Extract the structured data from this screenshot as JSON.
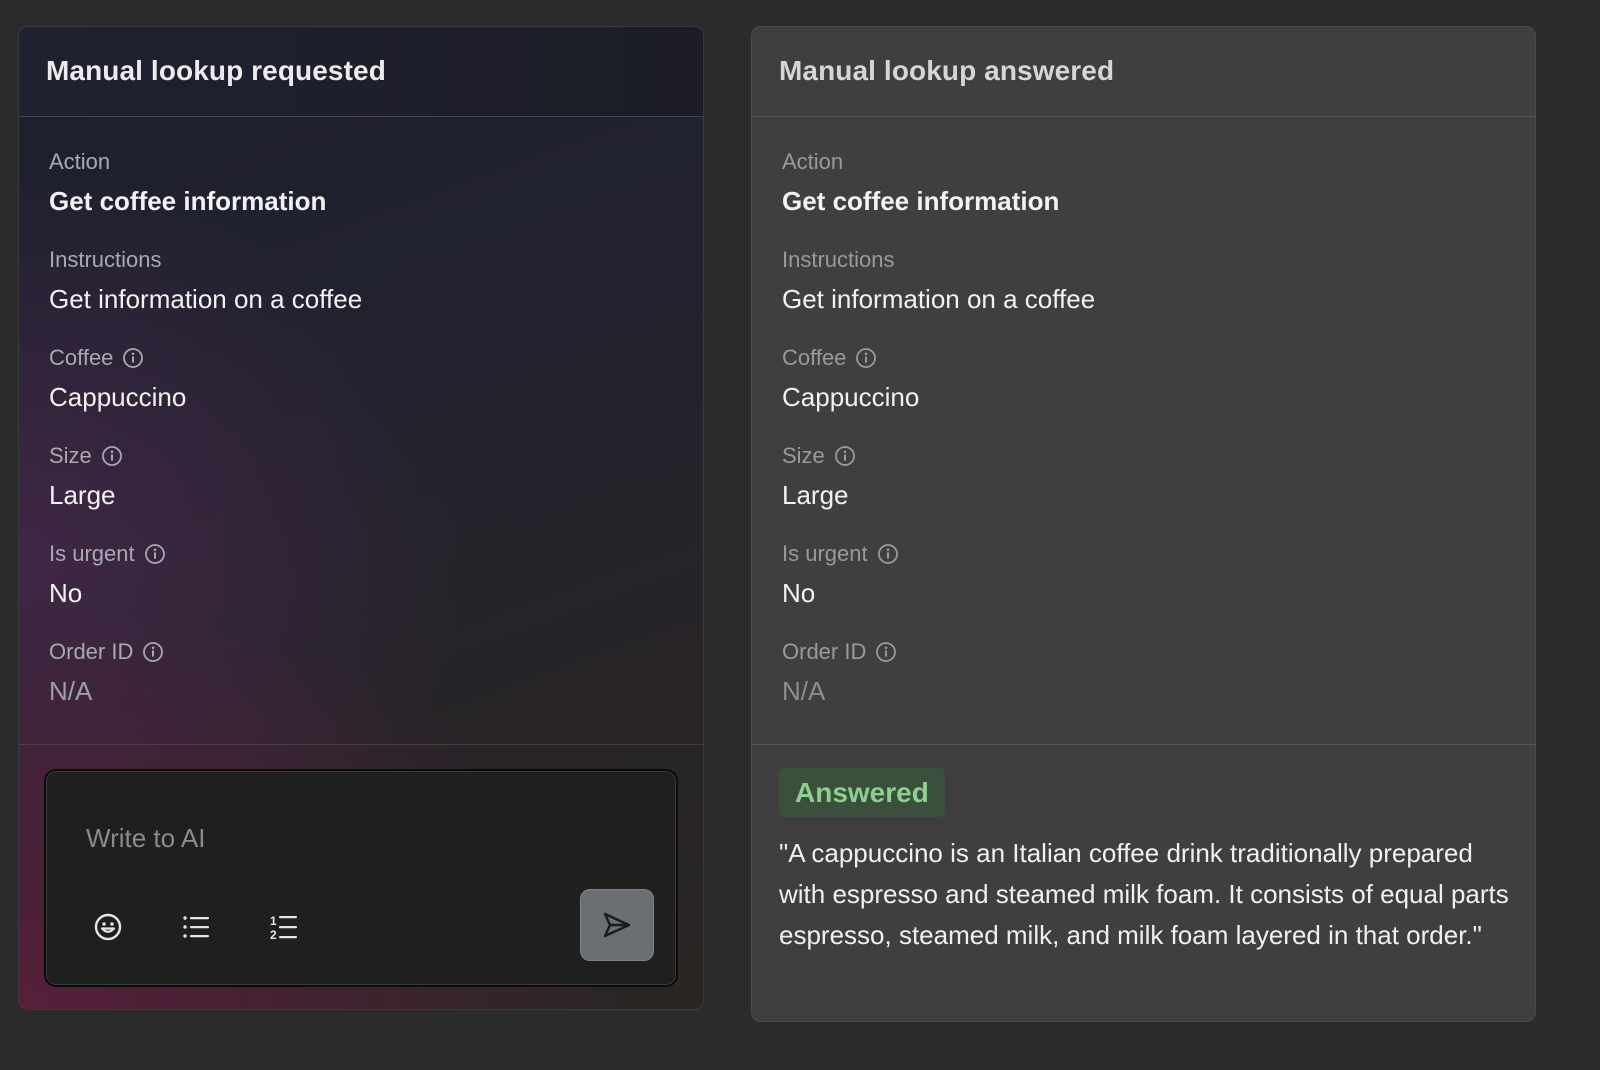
{
  "left_panel": {
    "title": "Manual lookup requested",
    "fields": {
      "action": {
        "label": "Action",
        "value": "Get coffee information"
      },
      "instructions": {
        "label": "Instructions",
        "value": "Get information on a coffee"
      },
      "coffee": {
        "label": "Coffee",
        "value": "Cappuccino"
      },
      "size": {
        "label": "Size",
        "value": "Large"
      },
      "is_urgent": {
        "label": "Is urgent",
        "value": "No"
      },
      "order_id": {
        "label": "Order ID",
        "value": "N/A"
      }
    },
    "composer": {
      "placeholder": "Write to AI",
      "tools": [
        "emoji-icon",
        "bullet-list-icon",
        "numbered-list-icon"
      ],
      "send_icon": "send-icon"
    }
  },
  "right_panel": {
    "title": "Manual lookup answered",
    "fields": {
      "action": {
        "label": "Action",
        "value": "Get coffee information"
      },
      "instructions": {
        "label": "Instructions",
        "value": "Get information on a coffee"
      },
      "coffee": {
        "label": "Coffee",
        "value": "Cappuccino"
      },
      "size": {
        "label": "Size",
        "value": "Large"
      },
      "is_urgent": {
        "label": "Is urgent",
        "value": "No"
      },
      "order_id": {
        "label": "Order ID",
        "value": "N/A"
      }
    },
    "status_badge": "Answered",
    "answer": "\"A cappuccino is an Italian coffee drink traditionally prepared with espresso and steamed milk foam. It consists of equal parts espresso, steamed milk, and milk foam layered in that order.\""
  },
  "colors": {
    "page_background": "#2b2b2b",
    "answered_badge_bg": "#3b4f3d",
    "answered_badge_text": "#8bd08e",
    "send_button": "#6b6e72"
  }
}
